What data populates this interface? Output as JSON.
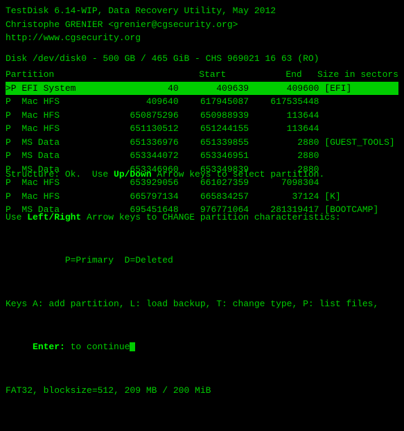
{
  "terminal": {
    "title": "TestDisk 6.14-WIP, Data Recovery Utility, May 2012"
  },
  "header": {
    "line1": "TestDisk 6.14-WIP, Data Recovery Utility, May 2012",
    "line2": "Christophe GRENIER <grenier@cgsecurity.org>",
    "line3": "http://www.cgsecurity.org"
  },
  "disk": {
    "info": "Disk /dev/disk0 - 500 GB / 465 GiB - CHS 969021 16 63 (RO)"
  },
  "columns": {
    "partition": "Partition",
    "start": "Start",
    "end": "End",
    "size": "Size in sectors"
  },
  "partitions": [
    {
      "selected": true,
      "flag": ">P",
      "type": "EFI System",
      "start": "40",
      "end": "409639",
      "size": "409600",
      "label": "[EFI]"
    },
    {
      "selected": false,
      "flag": "P",
      "type": "Mac HFS",
      "start": "409640",
      "end": "617945087",
      "size": "617535448",
      "label": ""
    },
    {
      "selected": false,
      "flag": "P",
      "type": "Mac HFS",
      "start": "650875296",
      "end": "650988939",
      "size": "113644",
      "label": ""
    },
    {
      "selected": false,
      "flag": "P",
      "type": "Mac HFS",
      "start": "651130512",
      "end": "651244155",
      "size": "113644",
      "label": ""
    },
    {
      "selected": false,
      "flag": "P",
      "type": "MS Data",
      "start": "651336976",
      "end": "651339855",
      "size": "2880",
      "label": "[GUEST_TOOLS]"
    },
    {
      "selected": false,
      "flag": "P",
      "type": "MS Data",
      "start": "653344072",
      "end": "653346951",
      "size": "2880",
      "label": ""
    },
    {
      "selected": false,
      "flag": "P",
      "type": "MS Data",
      "start": "653346960",
      "end": "653349839",
      "size": "2880",
      "label": ""
    },
    {
      "selected": false,
      "flag": "P",
      "type": "Mac HFS",
      "start": "653929056",
      "end": "661027359",
      "size": "7098304",
      "label": ""
    },
    {
      "selected": false,
      "flag": "P",
      "type": "Mac HFS",
      "start": "665797134",
      "end": "665834257",
      "size": "37124",
      "label": "[K]"
    },
    {
      "selected": false,
      "flag": "P",
      "type": "MS Data",
      "start": "695451648",
      "end": "976771064",
      "size": "281319417",
      "label": "[BOOTCAMP]"
    }
  ],
  "footer": {
    "line1": "Structure: Ok.  Use Up/Down Arrow keys to select partition.",
    "line2": "Use Left/Right Arrow keys to CHANGE partition characteristics:",
    "line3": "           P=Primary  D=Deleted",
    "line4": "Keys A: add partition, L: load backup, T: change type, P: list files,",
    "line5": "     Enter: to continue",
    "line6": "FAT32, blocksize=512, 209 MB / 200 MiB",
    "bold_updown": "Up/Down",
    "bold_leftright": "Left/Right",
    "bold_enter": "Enter:"
  }
}
